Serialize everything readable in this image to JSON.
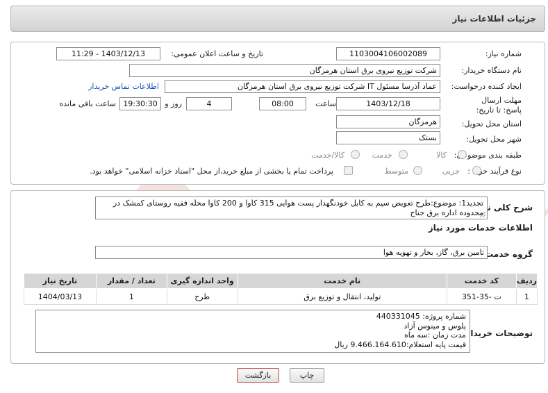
{
  "header": {
    "title": "جزئیات اطلاعات نیاز"
  },
  "form": {
    "need_number": {
      "label": "شماره نیاز:",
      "value": "1103004106002089"
    },
    "announce_datetime": {
      "label": "تاریخ و ساعت اعلان عمومی:",
      "value": "1403/12/13 - 11:29"
    },
    "buyer_org": {
      "label": "نام دستگاه خریدار:",
      "value": "شرکت توزیع نیروی برق استان هرمزگان"
    },
    "requester": {
      "label": "ایجاد کننده درخواست:",
      "value": "عماد آذرسا مسئول IT شرکت توزیع نیروی برق استان هرمزگان",
      "contact_link": "اطلاعات تماس خریدار"
    },
    "deadline": {
      "label": "مهلت ارسال پاسخ: تا تاریخ:",
      "date": "1403/12/18",
      "time_label": "ساعت",
      "time": "08:00",
      "days": "4",
      "days_label": "روز و",
      "remaining": "19:30:30",
      "remaining_label": "ساعت باقی مانده"
    },
    "province": {
      "label": "استان محل تحویل:",
      "value": "هرمزگان"
    },
    "city": {
      "label": "شهر محل تحویل:",
      "value": "بستک"
    },
    "category": {
      "label": "طبقه بندی موضوعی:",
      "options": [
        "کالا",
        "خدمت",
        "کالا/خدمت"
      ]
    },
    "process": {
      "label": "نوع فرآیند خرید :",
      "options": [
        "جزیی",
        "متوسط"
      ],
      "payment_note": "پرداخت تمام یا بخشی از مبلغ خرید،از محل \"اسناد خزانه اسلامی\" خواهد بود."
    }
  },
  "summary": {
    "label": "شرح کلی نیاز:",
    "text": "تجدید1: موضوع:طرح تعویض سیم به کابل خودنگهدار پست هوایی 315 کاوا و 200 کاوا محله فقیه روستای کمشک در محدوده اداره برق جناح"
  },
  "services": {
    "section_title": "اطلاعات خدمات مورد نیاز",
    "group_label": "گروه خدمت:",
    "group_value": "تامین برق، گاز، بخار و تهویه هوا",
    "columns": [
      "ردیف",
      "کد خدمت",
      "نام خدمت",
      "واحد اندازه گیری",
      "تعداد / مقدار",
      "تاریخ نیاز"
    ],
    "rows": [
      [
        "1",
        "ت -35-351",
        "تولید، انتقال و توزیع برق",
        "طرح",
        "1",
        "1404/03/13"
      ]
    ]
  },
  "buyer_notes": {
    "label": "توضیحات خریدار:",
    "lines": [
      "شماره پروژه:  440331045",
      "پلوس و مینوس آزاد",
      "مدت زمان :سه ماه",
      "قیمت پایه استعلام:9.466.164.610 ریال"
    ]
  },
  "buttons": {
    "print": "چاپ",
    "back": "بازگشت"
  },
  "watermark": {
    "text": "AriaTender.neT"
  },
  "colors": {
    "header_bg": "#dcdcdc",
    "link": "#1a52b8",
    "table_header": "#d6d6d6",
    "back_border": "#c24a4a"
  }
}
